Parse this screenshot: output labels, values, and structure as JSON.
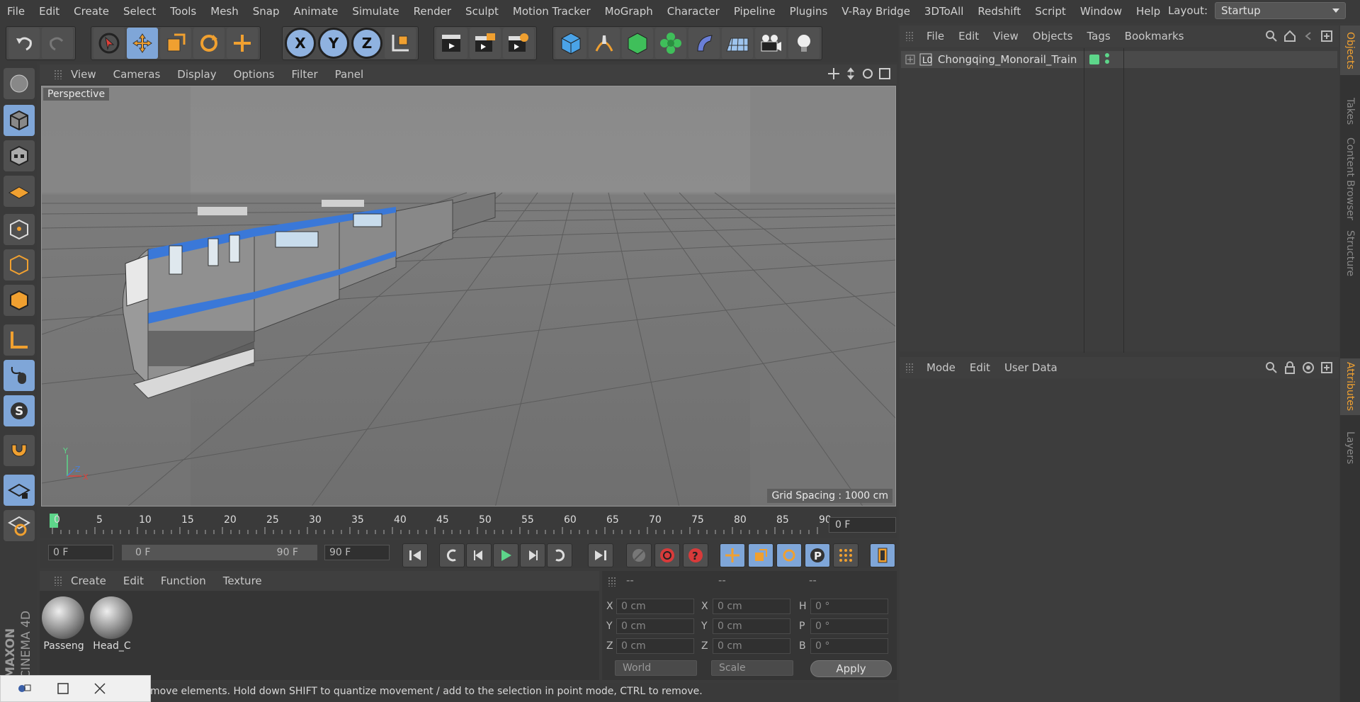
{
  "menubar": {
    "items": [
      "File",
      "Edit",
      "Create",
      "Select",
      "Tools",
      "Mesh",
      "Snap",
      "Animate",
      "Simulate",
      "Render",
      "Sculpt",
      "Motion Tracker",
      "MoGraph",
      "Character",
      "Pipeline",
      "Plugins",
      "V-Ray Bridge",
      "3DToAll",
      "Redshift",
      "Script",
      "Window",
      "Help"
    ],
    "layout_label": "Layout:",
    "layout_value": "Startup"
  },
  "toolbar": {
    "axis_x": "X",
    "axis_y": "Y",
    "axis_z": "Z"
  },
  "viewport": {
    "menu": [
      "View",
      "Cameras",
      "Display",
      "Options",
      "Filter",
      "Panel"
    ],
    "label": "Perspective",
    "grid_spacing": "Grid Spacing : 1000 cm",
    "axis_y": "Y",
    "axis_z": "Z",
    "axis_x": "X"
  },
  "timeline": {
    "ticks": [
      "0",
      "5",
      "10",
      "15",
      "20",
      "25",
      "30",
      "35",
      "40",
      "45",
      "50",
      "55",
      "60",
      "65",
      "70",
      "75",
      "80",
      "85",
      "90"
    ],
    "current_frame": "0 F",
    "start_field": "0 F",
    "range_start": "0 F",
    "range_end": "90 F",
    "end_field": "90 F"
  },
  "materials": {
    "menu": [
      "Create",
      "Edit",
      "Function",
      "Texture"
    ],
    "items": [
      {
        "label": "Passeng"
      },
      {
        "label": "Head_C"
      }
    ]
  },
  "coords": {
    "header": [
      "--",
      "--",
      "--"
    ],
    "rows": [
      {
        "a": "X",
        "av": "0 cm",
        "b": "X",
        "bv": "0 cm",
        "c": "H",
        "cv": "0 °"
      },
      {
        "a": "Y",
        "av": "0 cm",
        "b": "Y",
        "bv": "0 cm",
        "c": "P",
        "cv": "0 °"
      },
      {
        "a": "Z",
        "av": "0 cm",
        "b": "Z",
        "bv": "0 cm",
        "c": "B",
        "cv": "0 °"
      }
    ],
    "world": "World",
    "scale": "Scale",
    "apply": "Apply"
  },
  "status": "move elements. Hold down SHIFT to quantize movement / add to the selection in point mode, CTRL to remove.",
  "objects": {
    "menu": [
      "File",
      "Edit",
      "View",
      "Objects",
      "Tags",
      "Bookmarks"
    ],
    "item_name": "Chongqing_Monorail_Train",
    "layer_tag": "L0"
  },
  "attributes": {
    "menu": [
      "Mode",
      "Edit",
      "User Data"
    ]
  },
  "side_tabs": {
    "right_top": [
      "Objects",
      "Takes",
      "Content Browser",
      "Structure"
    ],
    "right_bottom": [
      "Attributes",
      "Layers"
    ]
  },
  "logo": {
    "line1": "MAXON",
    "line2": "CINEMA 4D"
  },
  "colors": {
    "accent_blue": "#7fa6d8",
    "orange": "#f0a030",
    "green": "#5dd68a"
  }
}
